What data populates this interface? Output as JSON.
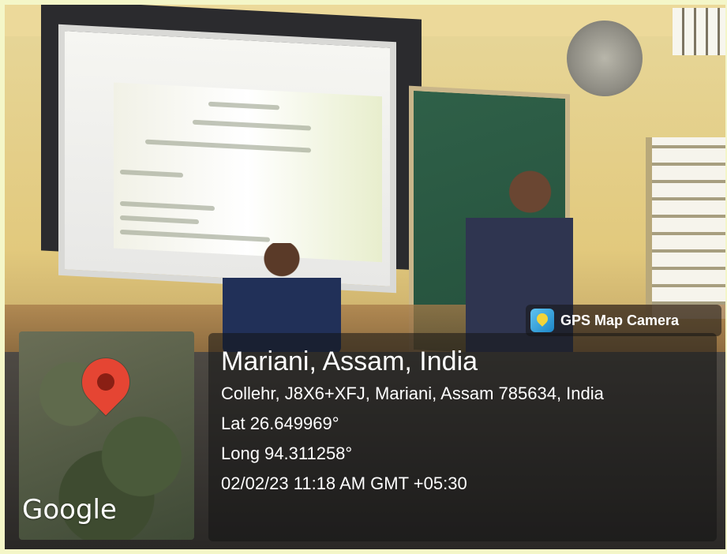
{
  "overlay": {
    "app_badge": "GPS Map Camera",
    "map_watermark": "Google",
    "location_title": "Mariani, Assam, India",
    "address": "Collehr, J8X6+XFJ, Mariani, Assam 785634, India",
    "latitude": "Lat 26.649969°",
    "longitude": "Long 94.311258°",
    "datetime": "02/02/23 11:18 AM GMT +05:30"
  },
  "colors": {
    "page_border": "#f4f6c8",
    "pin": "#e54533",
    "panel": "rgba(20,20,20,0.55)"
  },
  "icons": {
    "badge_icon": "gps-map-camera-app-icon",
    "pin_icon": "map-pin-icon"
  }
}
